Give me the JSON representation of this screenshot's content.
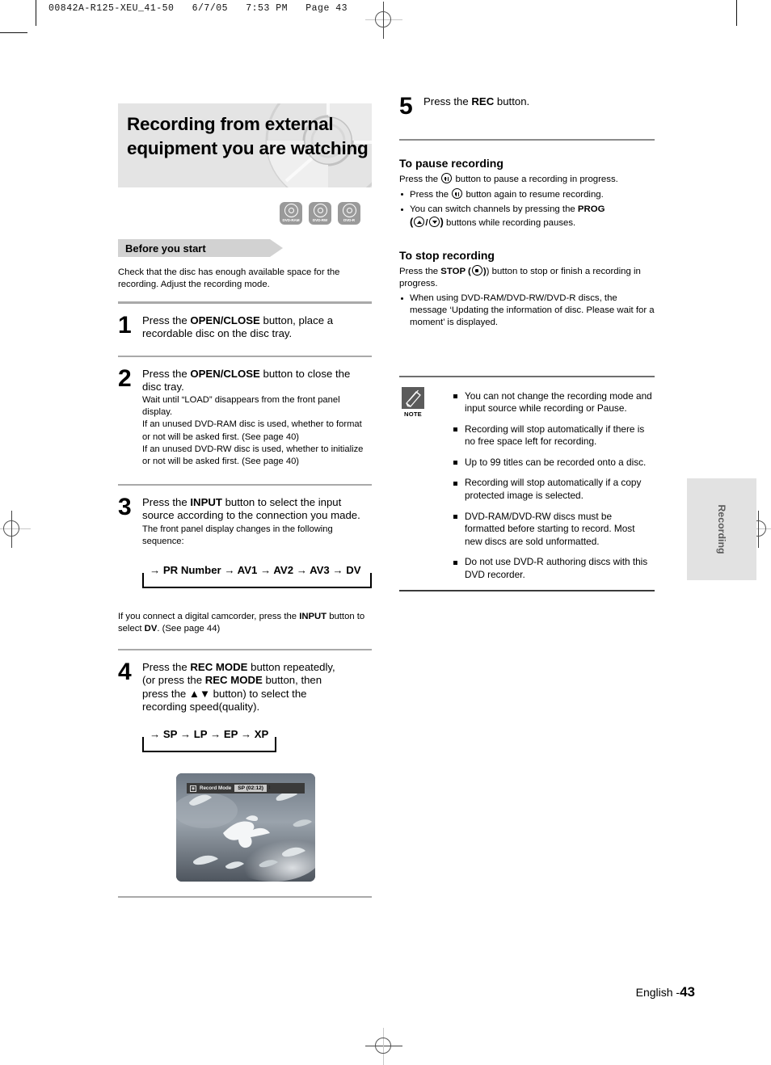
{
  "print_header": "00842A-R125-XEU_41-50   6/7/05   7:53 PM   Page 43",
  "left_column": {
    "title": "Recording from external equipment you are watching",
    "disc_badges": [
      {
        "label": "DVD-RAM"
      },
      {
        "label": "DVD-RW"
      },
      {
        "label": "DVD-R"
      }
    ],
    "chip_label": "Before you start",
    "intro": "Check that the disc has enough available space for the recording. Adjust the recording mode.",
    "steps": [
      {
        "number": "1",
        "lead_before": "Press the ",
        "lead_bold": "OPEN/CLOSE",
        "lead_after": " button, place a recordable disc on the disc tray.",
        "sub": ""
      },
      {
        "number": "2",
        "lead_before": "Press the ",
        "lead_bold": "OPEN/CLOSE",
        "lead_after": " button to close the disc tray.",
        "sub": "Wait until “LOAD” disappears from the front panel display.\nIf an unused DVD-RAM disc is used, whether to format or not will be asked first. (See page 40)\nIf an unused DVD-RW disc is used, whether to initialize or not will be asked first. (See page 40)"
      },
      {
        "number": "3",
        "lead_before": "Press the ",
        "lead_bold": "INPUT",
        "lead_after": " button to select the input source according to the connection you made.",
        "sub": "The front panel display changes in the following sequence:"
      },
      {
        "number": "4",
        "lead_before": "Press the ",
        "lead_bold": "REC MODE",
        "lead_after": " button repeatedly,",
        "sub": ""
      }
    ],
    "input_sequence": "→ PR Number → AV1 → AV2 → AV3 → DV",
    "camcorder_note_1": "If you connect a digital camcorder, press the ",
    "camcorder_note_bold_1": "INPUT",
    "camcorder_note_2": " button to select ",
    "camcorder_note_bold_2": "DV",
    "camcorder_note_3": ". (See page 44)",
    "step4_line1_before": "Press the ",
    "step4_line1_bold": "REC MODE",
    "step4_line1_after": " button repeatedly,",
    "step4_line2_before": "(or press the ",
    "step4_line2_bold": "REC MODE",
    "step4_line2_after": " button, then",
    "step4_line3": "press the ▲▼ button) to select the",
    "step4_line4": "recording speed(quality).",
    "speed_sequence": "→ SP → LP → EP → XP",
    "screen_osd": {
      "icon_name": "record-mode-icon",
      "label": "Record Mode",
      "value": "SP (02:12)",
      "arrows": "↕"
    }
  },
  "right_column": {
    "step5": {
      "number": "5",
      "text_before": "Press the ",
      "text_bold": "REC",
      "text_after": " button."
    },
    "pause_heading": "To pause recording",
    "pause_lead_1": "Press the ",
    "pause_lead_2": " button to pause a recording in progress.",
    "pause_bullets": [
      {
        "before": "Press the ",
        "after": " button again to resume recording."
      },
      {
        "before": "You can switch channels by pressing the ",
        "bold": "PROG",
        "after": " buttons while recording pauses.",
        "between": " ( ",
        "slash": " / ",
        "close": " ) "
      }
    ],
    "stop_heading": "To stop recording",
    "stop_lead_before": "Press the ",
    "stop_lead_bold": "STOP",
    "stop_lead_mid": " (",
    "stop_lead_after": ") button to stop or finish a recording in progress.",
    "stop_bullets": [
      "When using DVD-RAM/DVD-RW/DVD-R discs, the message ‘Updating the information of disc. Please wait for a moment’ is displayed."
    ],
    "note_label": "NOTE",
    "note_icon_name": "pencil-icon",
    "notes": [
      "You can not change the recording mode and input source while recording or Pause.",
      "Recording will stop automatically if there is no free space left for recording.",
      "Up to 99 titles can be recorded onto a disc.",
      "Recording will stop automatically if a copy protected image is selected.",
      "DVD-RAM/DVD-RW discs must be formatted before starting to record. Most new discs are sold unformatted.",
      "Do not use DVD-R authoring discs with this DVD recorder."
    ]
  },
  "side_tab": "Recording",
  "footer": {
    "language": "English -",
    "page_number": "43"
  },
  "colors": {
    "title_band": "#e4e4e4",
    "chip": "#d2d2d2",
    "badge": "#9a9a9a",
    "rule": "#a9a9a9",
    "note_icon": "#5b5b5b",
    "side_tab": "#e2e2e2"
  }
}
